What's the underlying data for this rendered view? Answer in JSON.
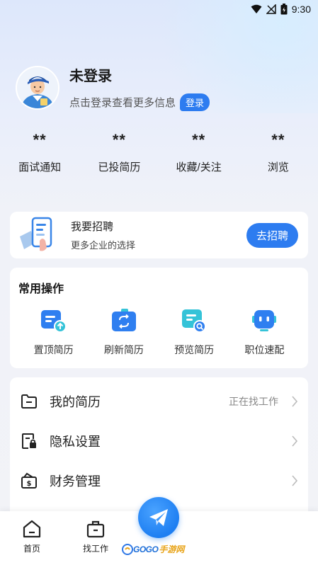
{
  "status_bar": {
    "time": "9:30"
  },
  "profile": {
    "name": "未登录",
    "hint": "点击登录查看更多信息",
    "login_label": "登录"
  },
  "stats": [
    {
      "value": "**",
      "label": "面试通知"
    },
    {
      "value": "**",
      "label": "已投简历"
    },
    {
      "value": "**",
      "label": "收藏/关注"
    },
    {
      "value": "**",
      "label": "浏览"
    }
  ],
  "recruit": {
    "title": "我要招聘",
    "subtitle": "更多企业的选择",
    "button_label": "去招聘"
  },
  "operations": {
    "title": "常用操作",
    "items": [
      {
        "label": "置顶简历",
        "icon": "pin-resume-icon"
      },
      {
        "label": "刷新简历",
        "icon": "refresh-resume-icon"
      },
      {
        "label": "预览简历",
        "icon": "preview-resume-icon"
      },
      {
        "label": "职位速配",
        "icon": "robot-match-icon"
      }
    ]
  },
  "menu": [
    {
      "label": "我的简历",
      "status": "正在找工作",
      "icon": "folder-icon"
    },
    {
      "label": "隐私设置",
      "status": "",
      "icon": "privacy-lock-icon"
    },
    {
      "label": "财务管理",
      "status": "",
      "icon": "wallet-icon"
    }
  ],
  "bottom_nav": [
    {
      "label": "首页",
      "icon": "home-icon"
    },
    {
      "label": "找工作",
      "icon": "briefcase-icon"
    }
  ],
  "watermark": {
    "text": "GOGO",
    "accent": "手游网"
  },
  "colors": {
    "accent": "#2d7cf0",
    "background": "#f2f3f7"
  }
}
